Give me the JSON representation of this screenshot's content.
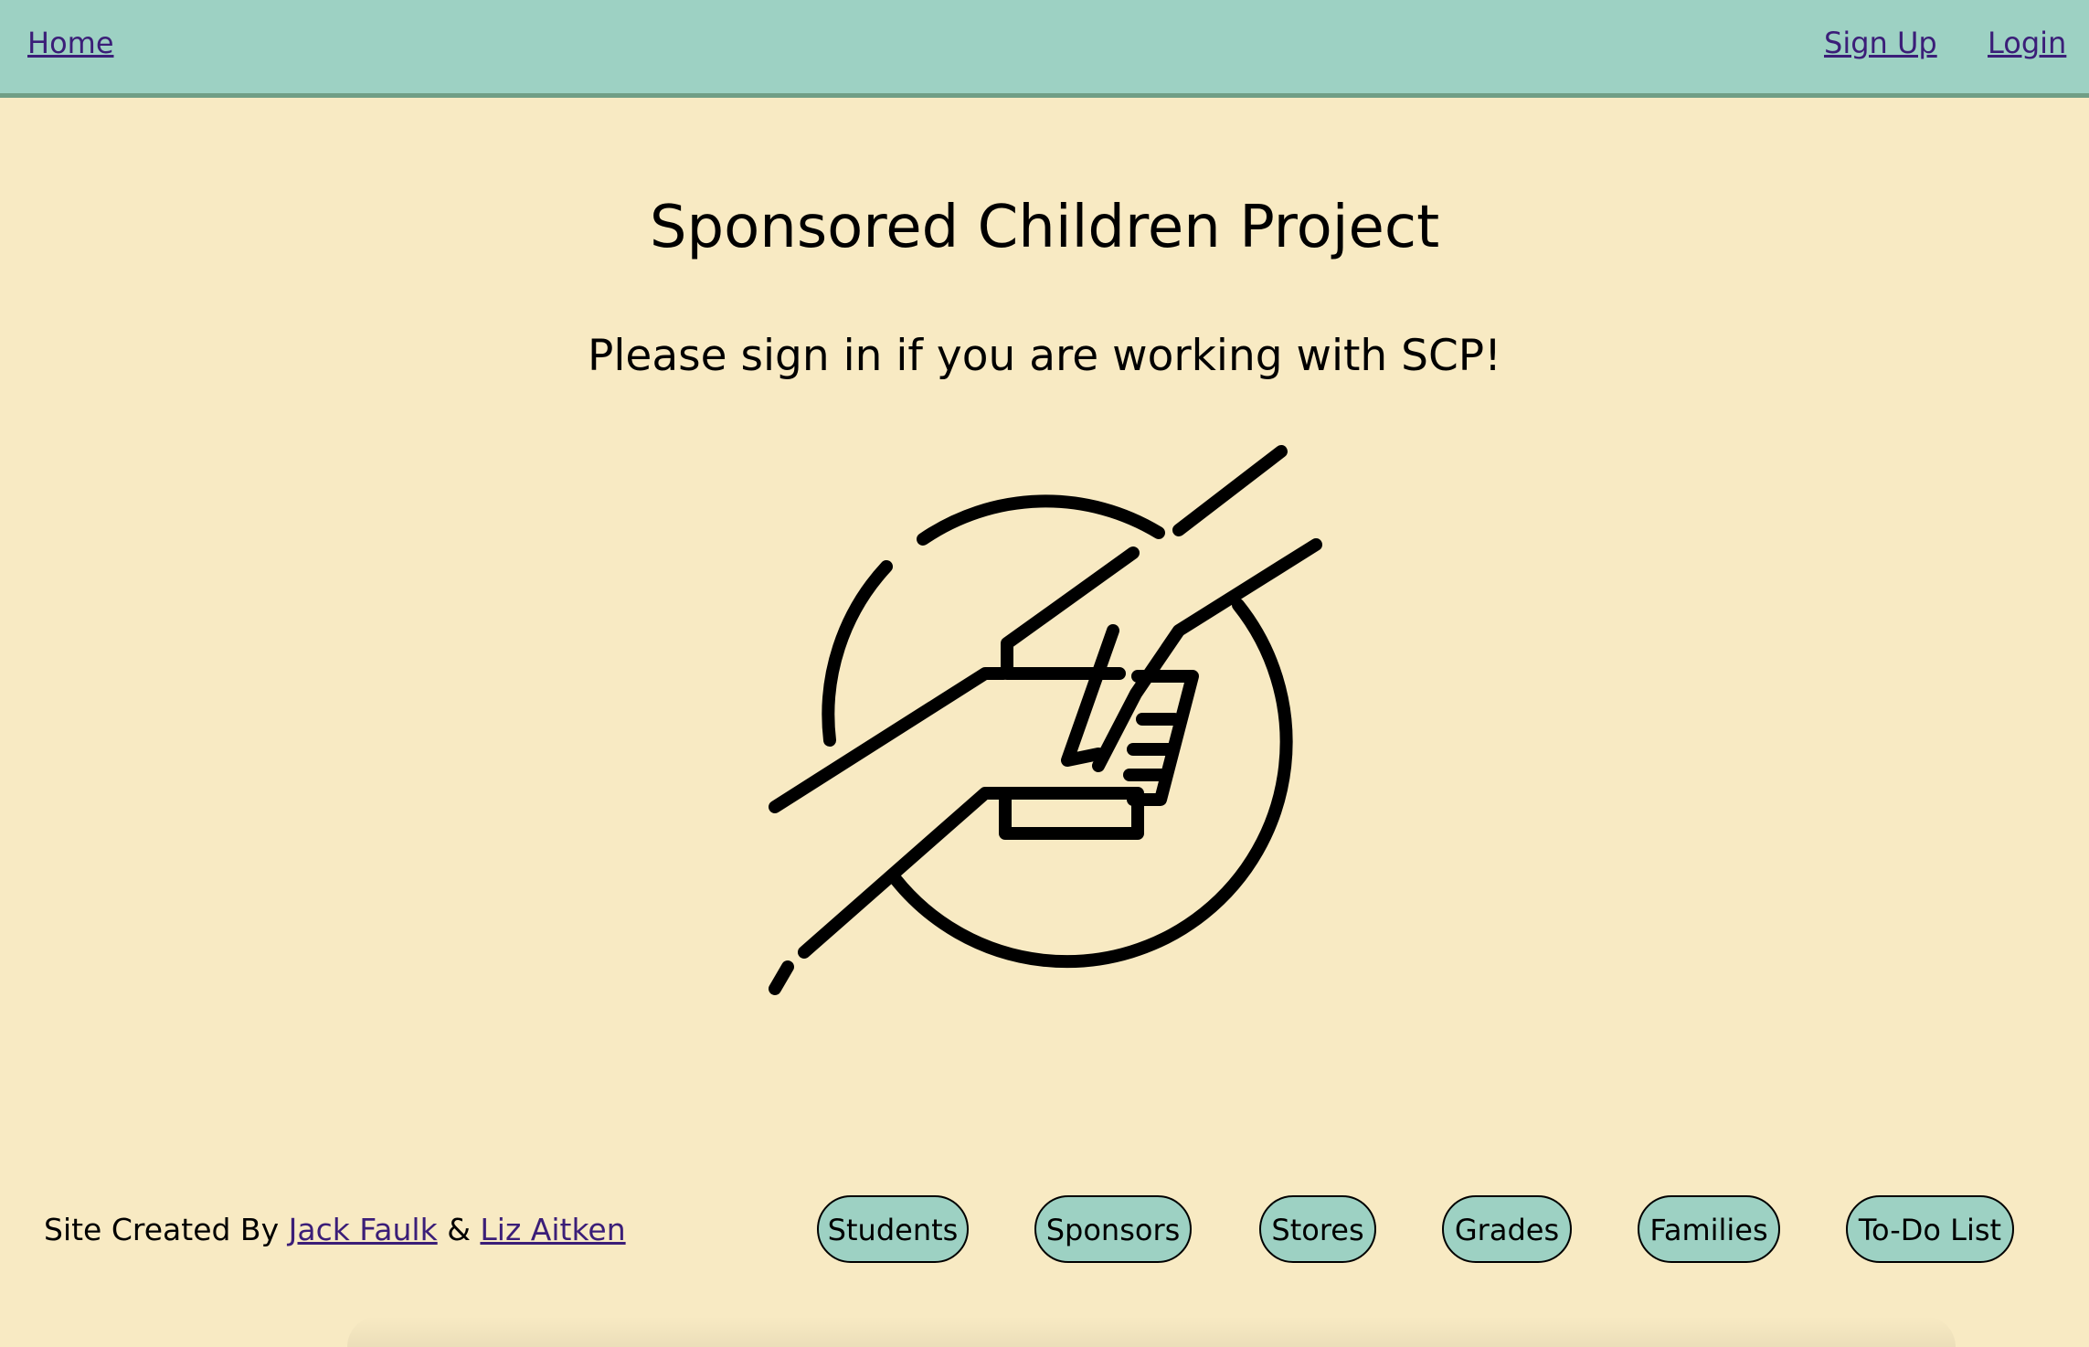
{
  "nav": {
    "home": "Home",
    "sign_up": "Sign Up",
    "login": "Login"
  },
  "main": {
    "title": "Sponsored Children Project",
    "subtitle": "Please sign in if you are working with SCP!",
    "logo_icon": "helping-hands-icon"
  },
  "footer": {
    "credit_prefix": "Site Created By",
    "author1": "Jack Faulk",
    "separator": "&",
    "author2": "Liz Aitken",
    "buttons": {
      "students": "Students",
      "sponsors": "Sponsors",
      "stores": "Stores",
      "grades": "Grades",
      "families": "Families",
      "todo": "To-Do List"
    }
  },
  "colors": {
    "background": "#f8eac3",
    "navbar": "#9dd1c3",
    "navbar_border": "#709e85",
    "link": "#3b1e78",
    "pill": "#9dd1c3"
  }
}
